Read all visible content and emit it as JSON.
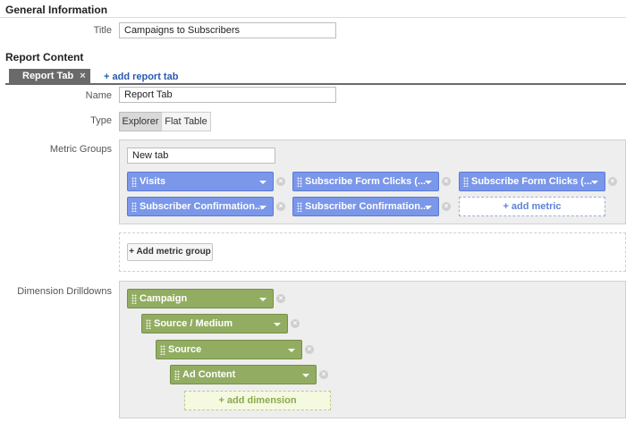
{
  "general": {
    "heading": "General Information",
    "title_label": "Title",
    "title_value": "Campaigns to Subscribers"
  },
  "report": {
    "heading": "Report Content",
    "tab_label": "Report Tab",
    "tab_close": "×",
    "add_tab": "+ add report tab",
    "name_label": "Name",
    "name_value": "Report Tab",
    "type_label": "Type",
    "type_options": [
      "Explorer",
      "Flat Table"
    ],
    "type_selected": "Explorer"
  },
  "metrics": {
    "label": "Metric Groups",
    "group_name": "New tab",
    "pills": [
      "Visits",
      "Subscribe Form Clicks (...",
      "Subscribe Form Clicks (...",
      "Subscriber Confirmation...",
      "Subscriber Confirmation..."
    ],
    "add_metric": "+ add metric",
    "add_group": "+ Add metric group",
    "color": "#7b97e9"
  },
  "dimensions": {
    "label": "Dimension Drilldowns",
    "pills": [
      "Campaign",
      "Source / Medium",
      "Source",
      "Ad Content"
    ],
    "add_dimension": "+ add dimension",
    "color": "#92ad62"
  }
}
